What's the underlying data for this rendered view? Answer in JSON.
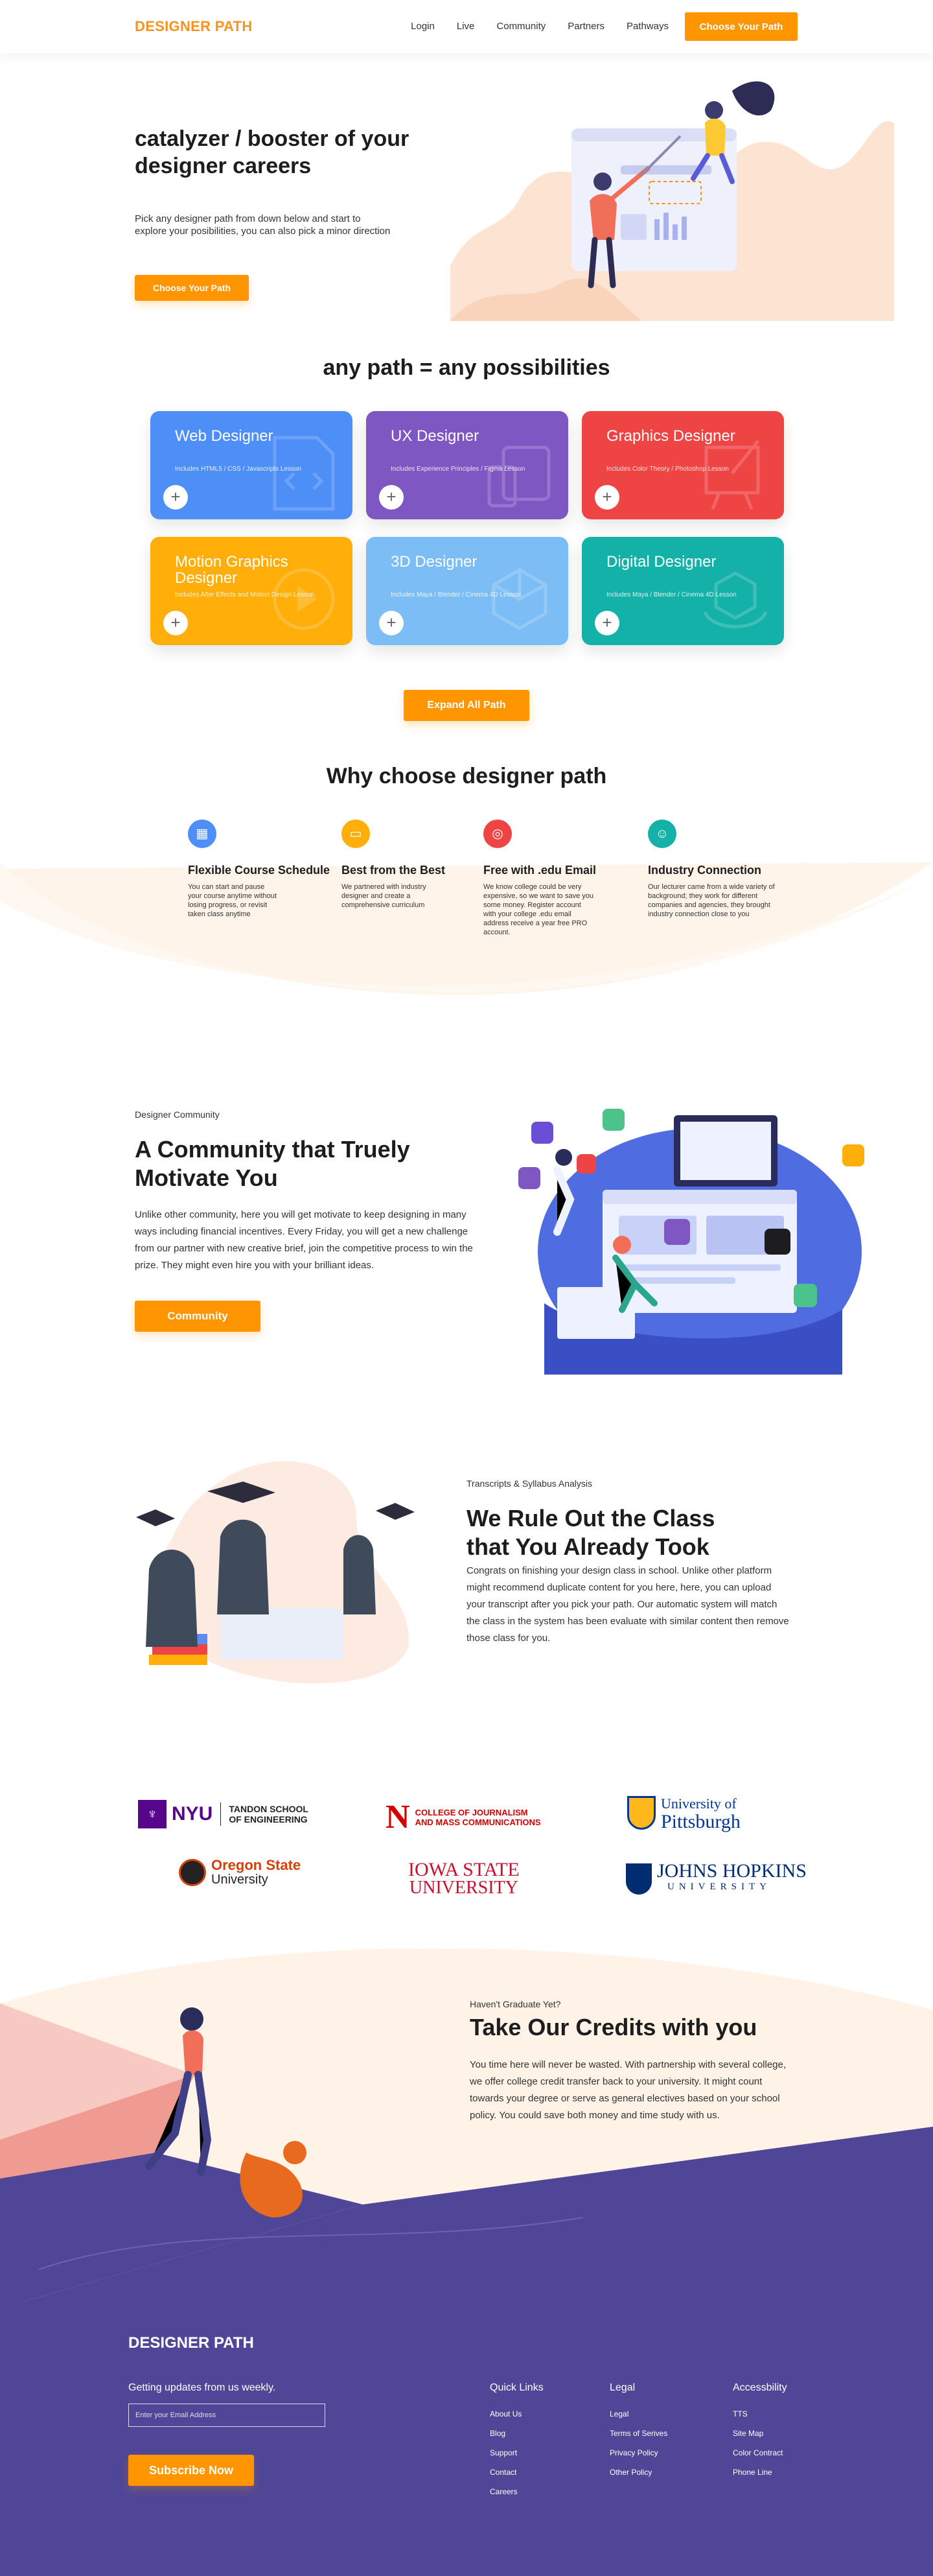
{
  "nav": {
    "logo": "DESIGNER PATH",
    "links": [
      "Login",
      "Live",
      "Community",
      "Partners",
      "Pathways"
    ],
    "cta": "Choose Your Path"
  },
  "hero": {
    "title": "catalyzer / booster of your designer careers",
    "subtitle": "Pick any designer path from down below and start to explore your posibilities, you can also pick a minor direction",
    "cta": "Choose Your Path"
  },
  "paths": {
    "title": "any path = any possibilities",
    "cards": [
      {
        "title": "Web Designer",
        "desc": "Includes HTML5 / CSS / Javascripts Lesson",
        "color": "#4D8EF7"
      },
      {
        "title": "UX Designer",
        "desc": "Includes Experience Principles / Figma Lesson",
        "color": "#7E57C2"
      },
      {
        "title": "Graphics Designer",
        "desc": "Includes Color Theory / Photoshop Lesson",
        "color": "#EF4444"
      },
      {
        "title": "Motion Graphics Designer",
        "desc": "Includes After Effects and Motion Design Lesson",
        "color": "#FFAE0A"
      },
      {
        "title": "3D Designer",
        "desc": "Includes Maya / Blender / Cinema 4D Lesson",
        "color": "#7CBDF5"
      },
      {
        "title": "Digital Designer",
        "desc": "Includes Maya / Blender / Cinema 4D Lesson",
        "color": "#14B1A8"
      }
    ],
    "expand": "Expand All Path"
  },
  "why": {
    "title": "Why choose designer path",
    "items": [
      {
        "title": "Flexible Course Schedule",
        "desc": "You can start and pause your course anytime without losing progress, or revisit taken class anytime",
        "color": "#4D8EF7",
        "icon": "calendar-icon"
      },
      {
        "title": "Best from the Best",
        "desc": "We partnered with industry designer and create a comprehensive curriculum",
        "color": "#FFAE0A",
        "icon": "folder-icon"
      },
      {
        "title": "Free with .edu Email",
        "desc": "We know college could be very expensive, so we want to save you some money. Register account with your college .edu email address receive a year free PRO account.",
        "color": "#EF4444",
        "icon": "target-icon"
      },
      {
        "title": "Industry Connection",
        "desc": "Our lecturer came from a wide variety of background; they work for different companies and agencies, they brought industry connection close to you",
        "color": "#14B1A8",
        "icon": "user-icon"
      }
    ]
  },
  "community": {
    "eyebrow": "Designer Community",
    "title": "A Community that Truely Motivate You",
    "body": "Unlike other community, here you will get motivate to keep designing in many ways including financial incentives. Every Friday, you will get a new challenge from our partner with new creative brief, join the competitive process to win the prize. They might even hire you with your brilliant ideas.",
    "cta": "Community"
  },
  "transcripts": {
    "eyebrow": "Transcripts & Syllabus Analysis",
    "title": "We Rule Out the Class that You Already Took",
    "body": "Congrats on finishing your design class in school. Unlike other platform might recommend duplicate content for you here, here, you can upload your transcript after you pick your path. Our automatic system will match the class in the system has been evaluate with similar content then remove those class for you."
  },
  "partners": {
    "nyu": {
      "mark": "NYU",
      "line1": "TANDON SCHOOL",
      "line2": "OF ENGINEERING"
    },
    "nebraska": {
      "mark": "N",
      "line1": "COLLEGE OF JOURNALISM",
      "line2": "AND MASS COMMUNICATIONS"
    },
    "pitt": {
      "line1": "University of",
      "line2": "Pittsburgh"
    },
    "oregon": {
      "line1": "Oregon State",
      "line2": "University"
    },
    "iowa": {
      "line1": "IOWA STATE",
      "line2": "UNIVERSITY"
    },
    "jhu": {
      "line1": "JOHNS HOPKINS",
      "line2": "UNIVERSITY"
    }
  },
  "credits": {
    "eyebrow": "Haven't Graduate Yet?",
    "title": "Take Our Credits with you",
    "body": "You time here will never be wasted. With partnership with several college, we offer college credit transfer back to your university. It might count towards your degree or serve as general electives based on your school policy. You could save both money and time study with us."
  },
  "footer": {
    "logo": "DESIGNER PATH",
    "updates": "Getting updates from us weekly.",
    "email_placeholder": "Enter your Email Address",
    "subscribe": "Subscribe Now",
    "columns": [
      {
        "title": "Quick Links",
        "links": [
          "About Us",
          "Blog",
          "Support",
          "Contact",
          "Careers"
        ]
      },
      {
        "title": "Legal",
        "links": [
          "Legal",
          "Terms of Serives",
          "Privacy Policy",
          "Other Policy"
        ]
      },
      {
        "title": "Accessbility",
        "links": [
          "TTS",
          "Site Map",
          "Color Contract",
          "Phone Line"
        ]
      }
    ]
  }
}
